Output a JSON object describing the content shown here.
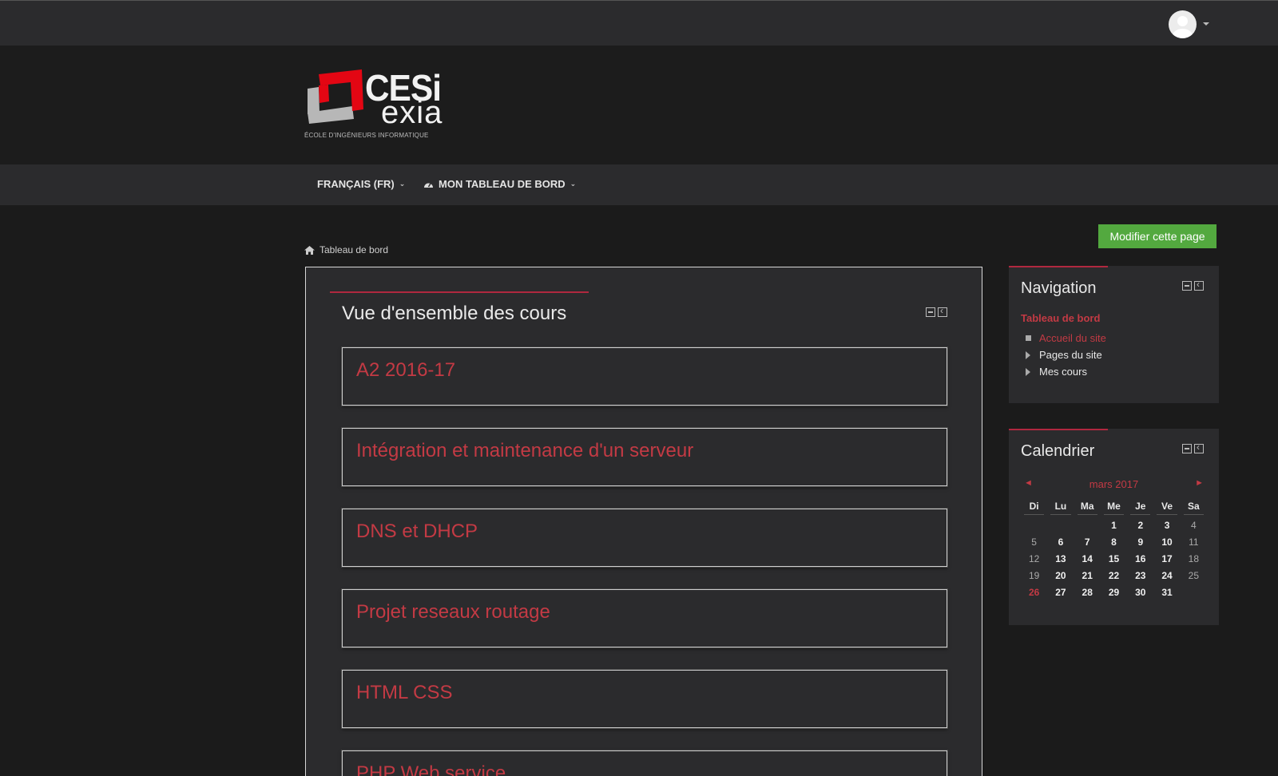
{
  "topbar": {
    "user_menu_icon": "avatar-icon",
    "caret_icon": "caret-down-icon"
  },
  "logo": {
    "brand_main": "CESi",
    "brand_sub": "exia",
    "tagline": "ÉCOLE D'INGÉNIEURS INFORMATIQUE",
    "colors": {
      "red": "#e30613",
      "grey": "#b7b7b7"
    }
  },
  "navbar": {
    "language": "FRANÇAIS (FR)",
    "dashboard": "MON TABLEAU DE BORD",
    "dashboard_icon": "dashboard-icon"
  },
  "page": {
    "edit_button": "Modifier cette page",
    "breadcrumb": "Tableau de bord",
    "breadcrumb_icon": "home-icon"
  },
  "course_overview": {
    "title": "Vue d'ensemble des cours",
    "courses": [
      "A2 2016-17",
      "Intégration et maintenance d'un serveur",
      "DNS et DHCP",
      "Projet reseaux routage",
      "HTML CSS",
      "PHP Web service"
    ]
  },
  "navigation_block": {
    "title": "Navigation",
    "root": "Tableau de bord",
    "items": [
      {
        "label": "Accueil du site",
        "type": "leaf",
        "active": true
      },
      {
        "label": "Pages du site",
        "type": "branch",
        "active": false
      },
      {
        "label": "Mes cours",
        "type": "branch",
        "active": false
      }
    ]
  },
  "calendar_block": {
    "title": "Calendrier",
    "month": "mars 2017",
    "prev": "◄",
    "next": "►",
    "days_of_week": [
      "Di",
      "Lu",
      "Ma",
      "Me",
      "Je",
      "Ve",
      "Sa"
    ],
    "first_weekday_index": 3,
    "days_in_month": 31,
    "today": 26
  },
  "accent_color": "#c33a44",
  "button_color": "#53a93f"
}
